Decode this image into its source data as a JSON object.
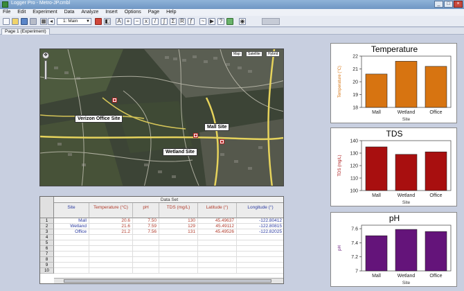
{
  "window": {
    "title": "Logger Pro - Metro-JP.cmbl",
    "minimize": "_",
    "maximize": "□",
    "close": "×"
  },
  "menu": [
    "File",
    "Edit",
    "Experiment",
    "Data",
    "Analyze",
    "Insert",
    "Options",
    "Page",
    "Help"
  ],
  "toolbar": {
    "page_select": "1: Main"
  },
  "page_tab": "Page 1 (Experiment)",
  "map": {
    "labels": {
      "verizon": "Verizon Office Site",
      "mall": "Mall Site",
      "wetland": "Wetland Site"
    },
    "map_types": [
      "Map",
      "Satellite",
      "Hybrid"
    ]
  },
  "table": {
    "group": "Data Set",
    "columns": [
      {
        "name": "Site",
        "color": "blue"
      },
      {
        "name": "Temperature (°C)",
        "color": "red"
      },
      {
        "name": "pH",
        "color": "red"
      },
      {
        "name": "TDS (mg/L)",
        "color": "red"
      },
      {
        "name": "Latitude (°)",
        "color": "red"
      },
      {
        "name": "Longitude (°)",
        "color": "blue"
      }
    ],
    "row_numbers": [
      "1",
      "2",
      "3",
      "4",
      "5",
      "6",
      "7",
      "8",
      "9",
      "10"
    ],
    "rows": [
      [
        "Mall",
        "20.6",
        "7.50",
        "130",
        "45.49637",
        "-122.80412"
      ],
      [
        "Wetland",
        "21.6",
        "7.59",
        "129",
        "45.49112",
        "-122.80815"
      ],
      [
        "Office",
        "21.2",
        "7.56",
        "131",
        "45.49526",
        "-122.82025"
      ]
    ]
  },
  "colors": {
    "temperature": "#d77411",
    "tds": "#a80f0f",
    "ph": "#64147a"
  },
  "chart_data": [
    {
      "type": "bar",
      "title": "Temperature",
      "categories": [
        "Mall",
        "Wetland",
        "Office"
      ],
      "values": [
        20.6,
        21.6,
        21.2
      ],
      "xlabel": "Site",
      "ylabel": "Temperature (°C)",
      "ylim": [
        18,
        22
      ],
      "yticks": [
        "18",
        "19",
        "20",
        "21",
        "22"
      ],
      "grid": false
    },
    {
      "type": "bar",
      "title": "TDS",
      "categories": [
        "Mall",
        "Wetland",
        "Office"
      ],
      "values": [
        135,
        129,
        131
      ],
      "xlabel": "Site",
      "ylabel": "TDS (mg/L)",
      "ylim": [
        100,
        140
      ],
      "yticks": [
        "100",
        "110",
        "120",
        "130",
        "140"
      ],
      "grid": false
    },
    {
      "type": "bar",
      "title": "pH",
      "categories": [
        "Mall",
        "Wetland",
        "Office"
      ],
      "values": [
        7.5,
        7.59,
        7.56
      ],
      "xlabel": "Site",
      "ylabel": "pH",
      "ylim": [
        7.0,
        7.65
      ],
      "yticks": [
        "7",
        "7.2",
        "7.4",
        "7.6"
      ],
      "grid": false
    }
  ]
}
